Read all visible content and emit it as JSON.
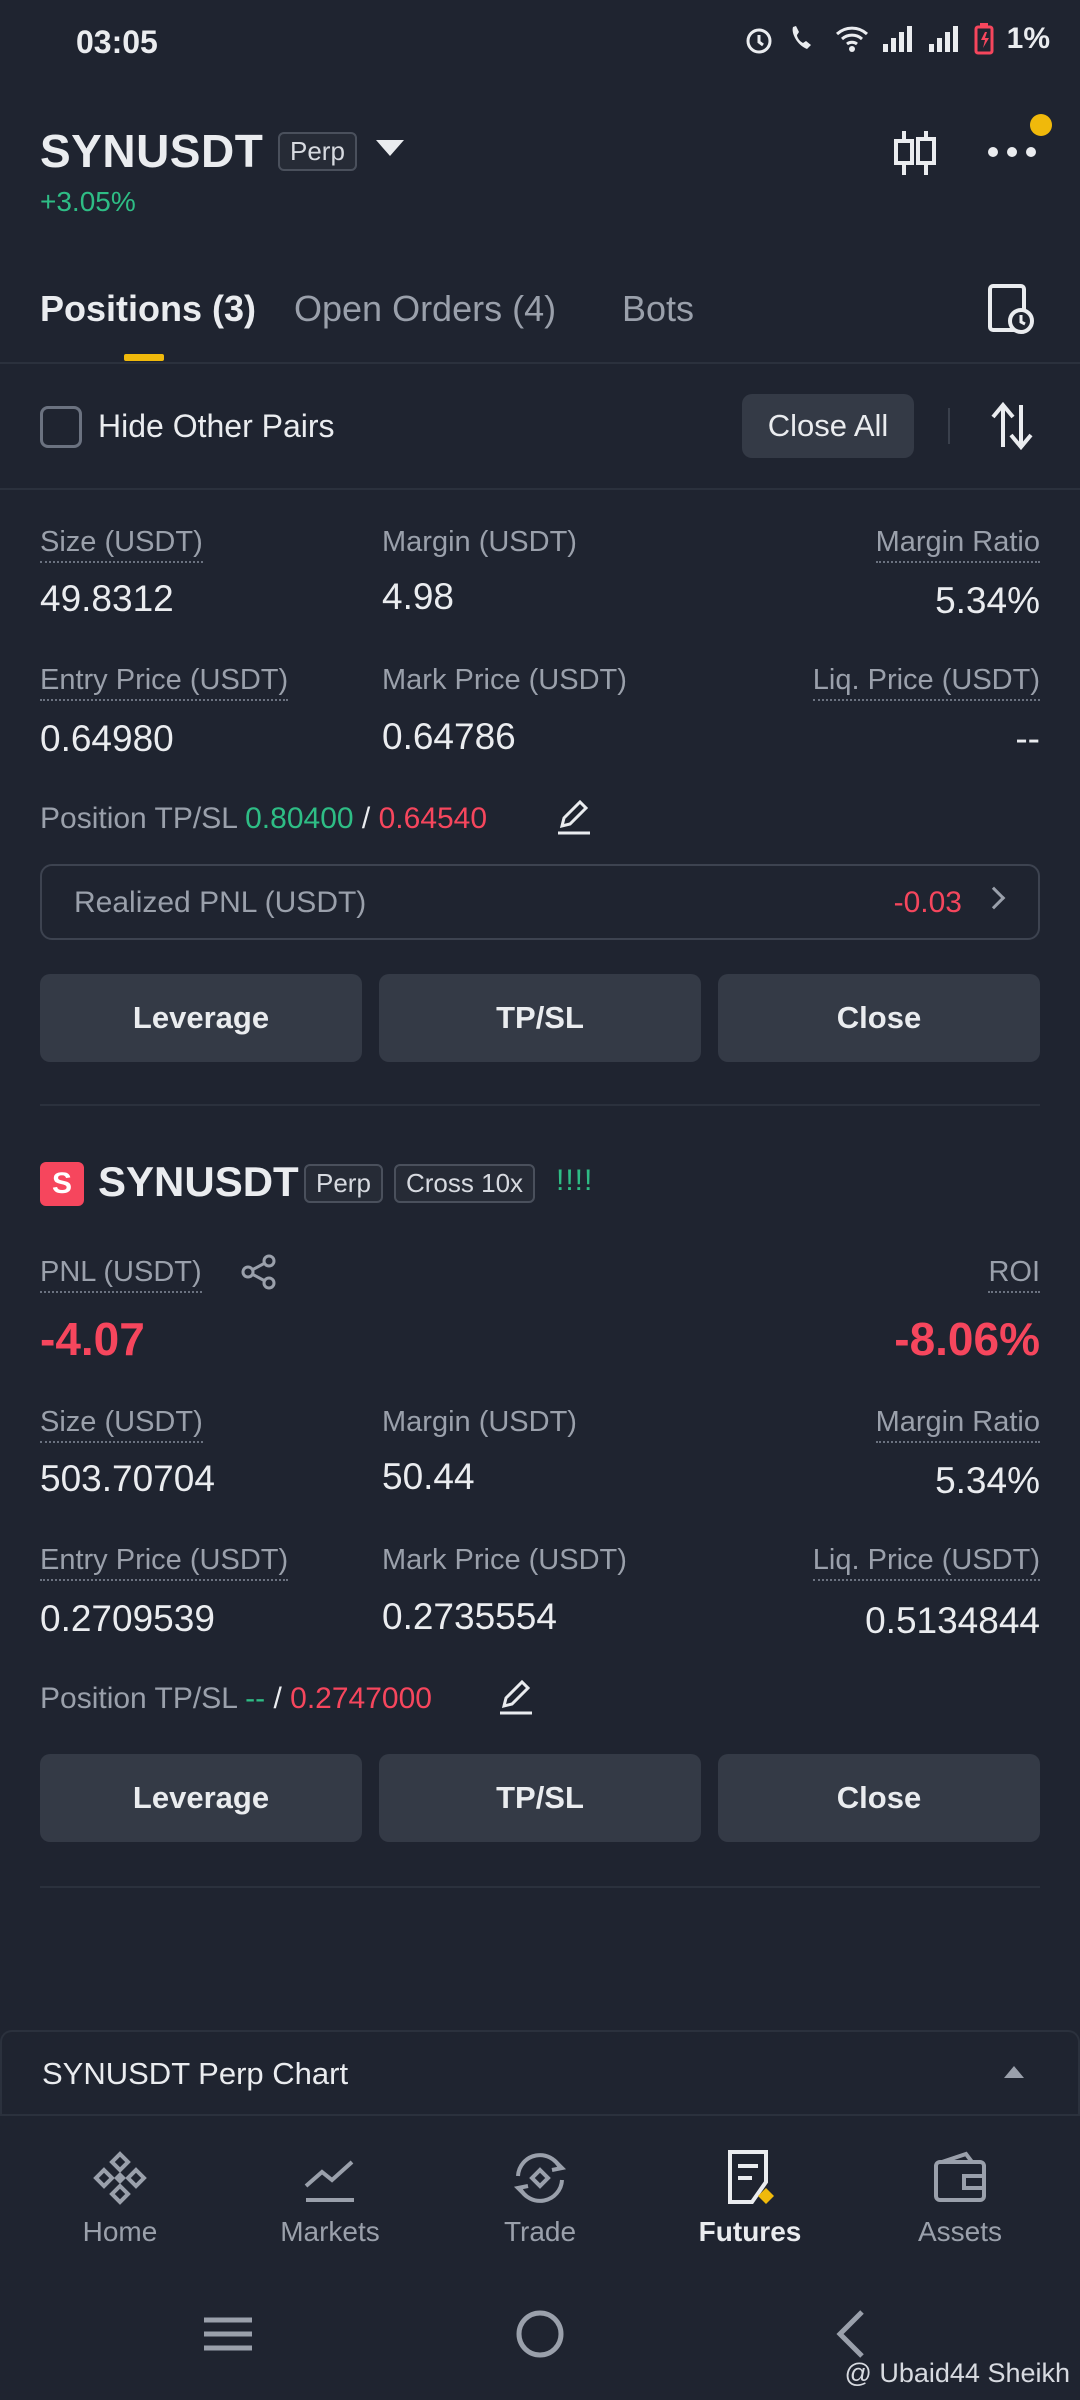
{
  "status_bar": {
    "time": "03:05",
    "battery": "1%"
  },
  "header": {
    "symbol": "SYNUSDT",
    "type_tag": "Perp",
    "change": "+3.05%"
  },
  "tabs": [
    {
      "label": "Positions (3)",
      "active": true
    },
    {
      "label": "Open Orders (4)",
      "active": false
    },
    {
      "label": "Bots",
      "active": false
    }
  ],
  "filter": {
    "hide_label": "Hide Other Pairs",
    "close_all": "Close All"
  },
  "position1": {
    "size_label": "Size (USDT)",
    "size": "49.8312",
    "margin_label": "Margin (USDT)",
    "margin": "4.98",
    "margin_ratio_label": "Margin Ratio",
    "margin_ratio": "5.34%",
    "entry_label": "Entry Price (USDT)",
    "entry": "0.64980",
    "mark_label": "Mark Price (USDT)",
    "mark": "0.64786",
    "liq_label": "Liq. Price (USDT)",
    "liq": "--",
    "tpsl_label": "Position TP/SL",
    "tp": "0.80400",
    "sl": "0.64540",
    "sep": "/",
    "realized_label": "Realized PNL (USDT)",
    "realized": "-0.03",
    "buttons": {
      "leverage": "Leverage",
      "tpsl": "TP/SL",
      "close": "Close"
    }
  },
  "position2": {
    "badge": "S",
    "symbol": "SYNUSDT",
    "type_tag": "Perp",
    "mode_tag": "Cross 10x",
    "signal": "!!!!",
    "pnl_label": "PNL (USDT)",
    "pnl": "-4.07",
    "roi_label": "ROI",
    "roi": "-8.06%",
    "size_label": "Size (USDT)",
    "size": "503.70704",
    "margin_label": "Margin (USDT)",
    "margin": "50.44",
    "margin_ratio_label": "Margin Ratio",
    "margin_ratio": "5.34%",
    "entry_label": "Entry Price (USDT)",
    "entry": "0.2709539",
    "mark_label": "Mark Price (USDT)",
    "mark": "0.2735554",
    "liq_label": "Liq. Price (USDT)",
    "liq": "0.5134844",
    "tpsl_label": "Position TP/SL",
    "tp": "--",
    "sl": "0.2747000",
    "sep": "/",
    "buttons": {
      "leverage": "Leverage",
      "tpsl": "TP/SL",
      "close": "Close"
    }
  },
  "chart_bar": {
    "title": "SYNUSDT Perp Chart"
  },
  "bottom_nav": [
    {
      "label": "Home",
      "icon": "home-icon"
    },
    {
      "label": "Markets",
      "icon": "markets-icon"
    },
    {
      "label": "Trade",
      "icon": "trade-icon"
    },
    {
      "label": "Futures",
      "icon": "futures-icon",
      "active": true
    },
    {
      "label": "Assets",
      "icon": "assets-icon"
    }
  ],
  "watermark": "@ Ubaid44 Sheikh",
  "colors": {
    "accent": "#f0b90b",
    "green": "#2ebd85",
    "red": "#f6465d",
    "bg": "#1f2430"
  }
}
